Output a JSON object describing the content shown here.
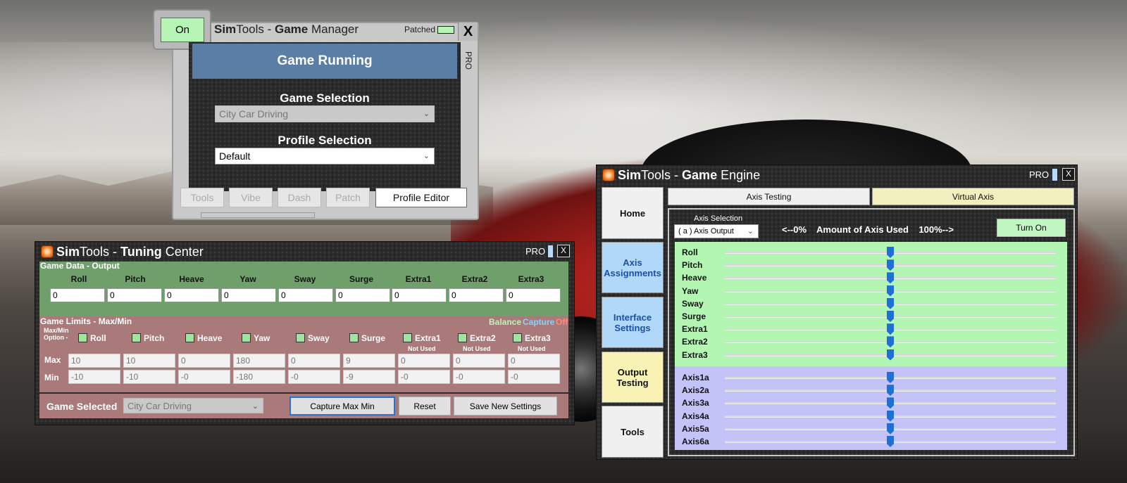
{
  "game_manager": {
    "on_button": "On",
    "title_parts": [
      "Sim",
      "Tools - ",
      "Game",
      " Manager"
    ],
    "patched_label": "Patched",
    "close": "X",
    "side_label": "PRO",
    "status": "Game Running",
    "game_selection_label": "Game Selection",
    "game_selection_value": "City Car Driving",
    "profile_selection_label": "Profile Selection",
    "profile_selection_value": "Default",
    "tabs": [
      "Tools",
      "Vibe",
      "Dash",
      "Patch",
      "Profile Editor"
    ]
  },
  "tuning_center": {
    "title_parts": [
      "Sim",
      "Tools - ",
      "Tuning",
      " Center"
    ],
    "pro": "PRO",
    "close": "X",
    "game_data_label": "Game Data - Output",
    "columns": [
      "Roll",
      "Pitch",
      "Heave",
      "Yaw",
      "Sway",
      "Surge",
      "Extra1",
      "Extra2",
      "Extra3"
    ],
    "output_values": [
      "0",
      "0",
      "0",
      "0",
      "0",
      "0",
      "0",
      "0",
      "0"
    ],
    "limits_label": "Game Limits - Max/Min",
    "balance": "Balance",
    "capture": "Capture",
    "off": "Off",
    "option_label_1": "Max/Min",
    "option_label_2": "Option -",
    "not_used": "Not Used",
    "max_label": "Max",
    "min_label": "Min",
    "max_values": [
      "10",
      "10",
      "0",
      "180",
      "0",
      "9",
      "0",
      "0",
      "0"
    ],
    "min_values": [
      "-10",
      "-10",
      "-0",
      "-180",
      "-0",
      "-9",
      "-0",
      "-0",
      "-0"
    ],
    "game_selected_label": "Game Selected",
    "game_selected_value": "City Car Driving",
    "capture_button": "Capture Max Min",
    "reset_button": "Reset",
    "save_button": "Save New Settings"
  },
  "game_engine": {
    "title_parts": [
      "Sim",
      "Tools - ",
      "Game",
      " Engine"
    ],
    "pro": "PRO",
    "close": "X",
    "nav": [
      "Home",
      "Axis Assignments",
      "Interface Settings",
      "Output Testing",
      "Tools"
    ],
    "tabs": [
      "Axis Testing",
      "Virtual Axis"
    ],
    "axis_selection_label": "Axis Selection",
    "axis_selection_value": "( a ) Axis Output",
    "amount_text": "<--0%    Amount of Axis Used    100%-->",
    "turn_on": "Turn On",
    "dof_rows": [
      "Roll",
      "Pitch",
      "Heave",
      "Yaw",
      "Sway",
      "Surge",
      "Extra1",
      "Extra2",
      "Extra3"
    ],
    "axis_rows": [
      "Axis1a",
      "Axis2a",
      "Axis3a",
      "Axis4a",
      "Axis5a",
      "Axis6a"
    ],
    "slider_level": 0.5
  }
}
